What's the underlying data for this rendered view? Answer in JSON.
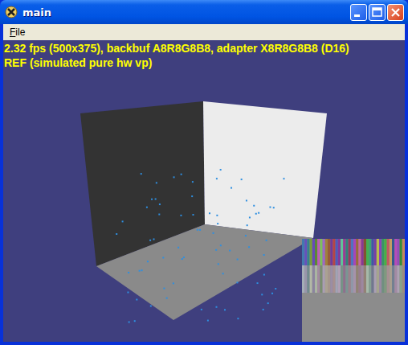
{
  "window": {
    "title": "main"
  },
  "menu": [
    {
      "label": "File"
    }
  ],
  "overlay": {
    "lines": [
      "2.32 fps (500x375), backbuf A8R8G8B8, adapter X8R8G8B8 (D16)",
      "REF (simulated pure hw vp)"
    ]
  }
}
